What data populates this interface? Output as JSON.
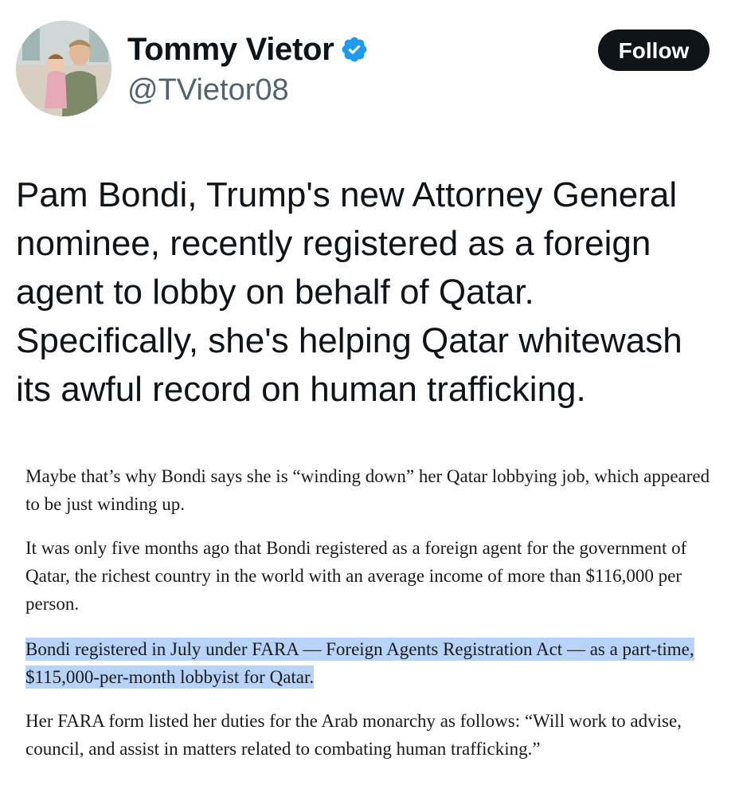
{
  "author": {
    "display_name": "Tommy Vietor",
    "handle": "@TVietor08",
    "verified": true,
    "avatar": "avatar-photo-man-holding-baby"
  },
  "follow_button": {
    "label": "Follow"
  },
  "tweet": {
    "text": "Pam Bondi, Trump's new Attorney General nominee, recently registered as a foreign agent to lobby on behalf of Qatar. Specifically, she's helping Qatar whitewash its awful record on human trafficking."
  },
  "article_excerpt": {
    "paragraphs": [
      "Maybe that’s why Bondi says she is “winding down” her Qatar lobbying job, which appeared to be just winding up.",
      "It was only five months ago that Bondi registered as a foreign agent for the government of Qatar, the richest country in the world with an average income of more than $116,000 per person.",
      "Bondi registered in July under FARA — Foreign Agents Registration Act — as a part-time, $115,000-per-month lobbyist for Qatar.",
      "Her FARA form listed her duties for the Arab monarchy as follows: “Will work to advise, council, and assist in matters related to combating human trafficking.”"
    ],
    "highlighted_paragraph_index": 2
  },
  "colors": {
    "text_primary": "#0f1419",
    "text_secondary": "#536471",
    "verified_blue": "#1d9bf0",
    "follow_bg": "#0f1419",
    "highlight": "#b8d3f8"
  }
}
